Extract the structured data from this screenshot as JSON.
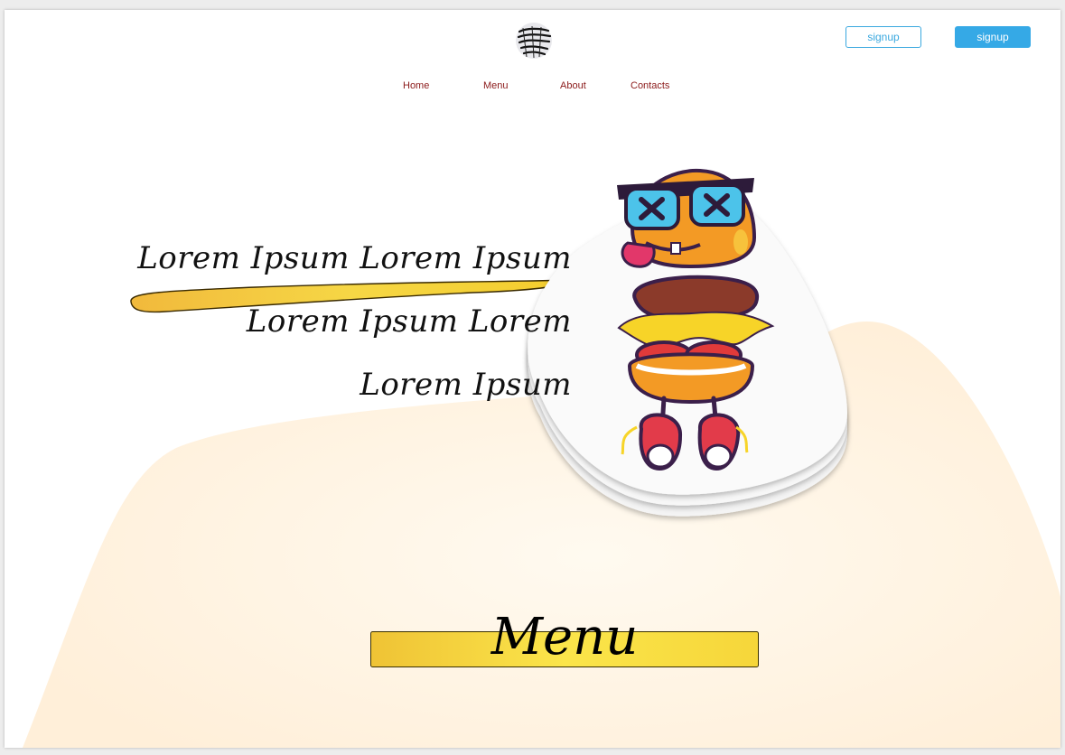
{
  "header": {
    "logo_icon": "street-burger-logo-icon",
    "signin_label": "signup",
    "signup_label": "signup"
  },
  "nav": {
    "items": [
      {
        "label": "Home"
      },
      {
        "label": "Menu"
      },
      {
        "label": "About"
      },
      {
        "label": "Contacts"
      }
    ]
  },
  "hero": {
    "line1": "Lorem Ipsum Lorem Ipsum",
    "line2": "Lorem Ipsum Lorem",
    "line3": "Lorem Ipsum",
    "image_icon": "burger-mascot-icon"
  },
  "section": {
    "title": "Menu"
  },
  "colors": {
    "accent_blue": "#35a9e6",
    "nav_text": "#8b1a1a",
    "highlight_yellow": "#f5d53a",
    "blob_peach": "#fff1dc"
  }
}
